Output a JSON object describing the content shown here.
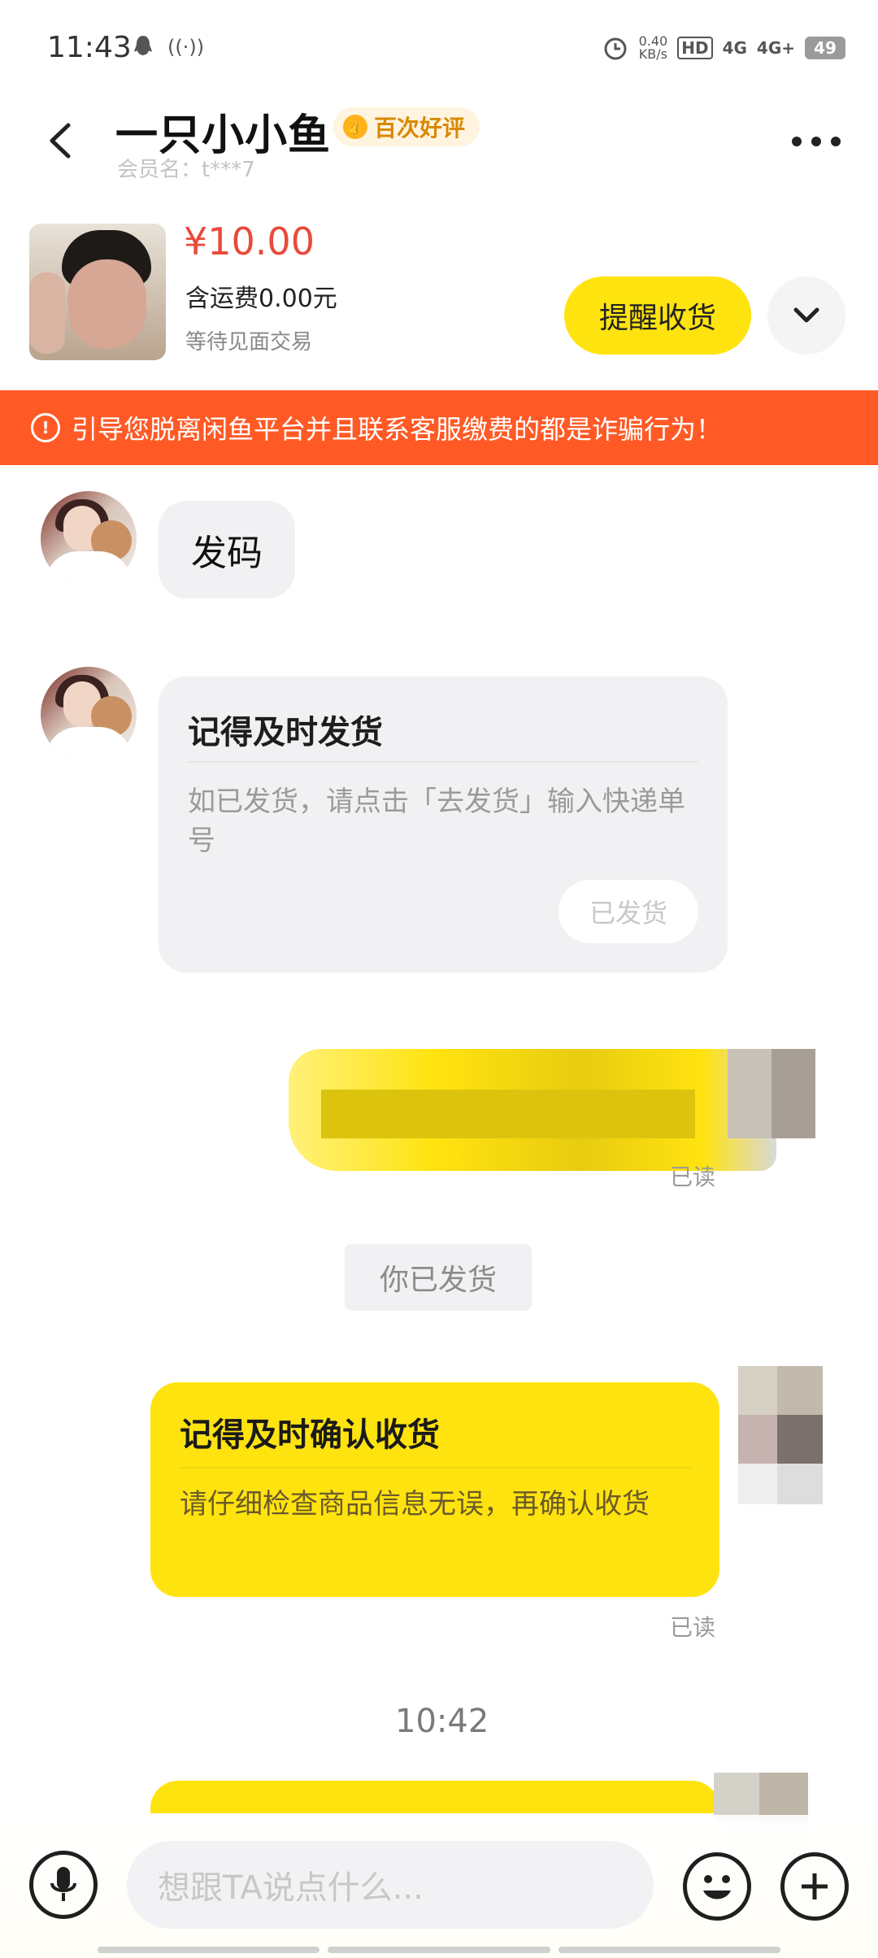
{
  "status_bar": {
    "time": "11:43",
    "speed_value": "0.40",
    "speed_unit": "KB/s",
    "hd": "HD",
    "net1": "4G",
    "net2": "4G+",
    "battery": "49"
  },
  "header": {
    "title": "一只小小鱼",
    "badge": "百次好评",
    "member": "会员名：t***7"
  },
  "product": {
    "price": "¥10.00",
    "shipping": "含运费0.00元",
    "status": "等待见面交易",
    "remind_button": "提醒收货"
  },
  "warning": "引导您脱离闲鱼平台并且联系客服缴费的都是诈骗行为！",
  "messages": {
    "m1": "发码",
    "card1": {
      "title": "记得及时发货",
      "body": "如已发货，请点击「去发货」输入快递单号",
      "button": "已发货"
    },
    "read": "已读",
    "system": "你已发货",
    "card2": {
      "title": "记得及时确认收货",
      "body": "请仔细检查商品信息无误，再确认收货"
    },
    "time": "10:42"
  },
  "input": {
    "placeholder": "想跟TA说点什么..."
  },
  "colors": {
    "accent": "#ffe30f",
    "warning": "#ff5a26",
    "price": "#e94a3b"
  }
}
